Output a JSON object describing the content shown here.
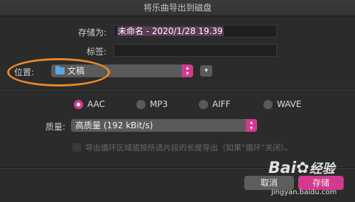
{
  "dialog": {
    "title": "将乐曲导出到磁盘"
  },
  "form": {
    "save_as_label": "存储为:",
    "save_as_value": "未命名 - 2020/1/28 19.39",
    "tags_label": "标签:",
    "tags_value": "",
    "location_label": "位置:",
    "location_value": "文稿",
    "location_icon": "folder-icon"
  },
  "format": {
    "options": [
      {
        "label": "AAC",
        "selected": true
      },
      {
        "label": "MP3",
        "selected": false
      },
      {
        "label": "AIFF",
        "selected": false
      },
      {
        "label": "WAVE",
        "selected": false
      }
    ]
  },
  "quality": {
    "label": "质量:",
    "value": "高质量 (192 kBit/s)"
  },
  "cycle_option": {
    "label": "导出循环区域或按所选片段的长度导出（如果“循环”关闭）。",
    "checked": false,
    "enabled": false
  },
  "buttons": {
    "cancel": "取消",
    "save": "存储"
  },
  "colors": {
    "accent": "#d13a8e",
    "highlight": "#e8892a"
  },
  "watermark": {
    "brand": "Bai",
    "brand2": "经验",
    "url": "jingyan.baidu.com"
  }
}
